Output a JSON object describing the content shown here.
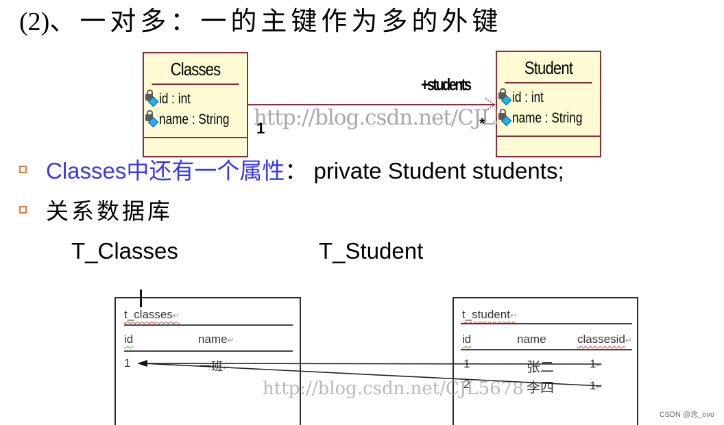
{
  "title": {
    "number": "(2)",
    "text": "、一对多：一的主键作为多的外键"
  },
  "uml": {
    "classes": {
      "name": "Classes",
      "attributes": [
        "id : int",
        "name : String"
      ]
    },
    "student": {
      "name": "Student",
      "attributes": [
        "id : int",
        "name : String"
      ]
    },
    "association": {
      "role": "+students",
      "source_multiplicity": "1",
      "target_multiplicity": "*"
    },
    "colors": {
      "border": "#8a2e3d",
      "fill": "#fefbd5"
    }
  },
  "watermark": "http://blog.csdn.net/CJL5678",
  "bullets": [
    {
      "blue_part": "Classes中还有一个属性",
      "black_part": "：  private Student students;"
    },
    {
      "blue_part": "",
      "black_part": "关系数据库"
    }
  ],
  "table_labels": {
    "left": "T_Classes",
    "right": "T_Student"
  },
  "db_tables": {
    "t_classes": {
      "name": "t_classes",
      "columns": [
        "id",
        "name"
      ],
      "rows": [
        [
          "1",
          "一班"
        ]
      ]
    },
    "t_student": {
      "name": "t_student",
      "columns": [
        "id",
        "name",
        "classesid"
      ],
      "rows": [
        [
          "1",
          "张二",
          "1"
        ],
        [
          "2",
          "李四",
          "1"
        ]
      ]
    }
  },
  "credit": "CSDN @念_ovo",
  "colors": {
    "bullet_box": "#e07c3e",
    "blue_text": "#3838f0"
  }
}
